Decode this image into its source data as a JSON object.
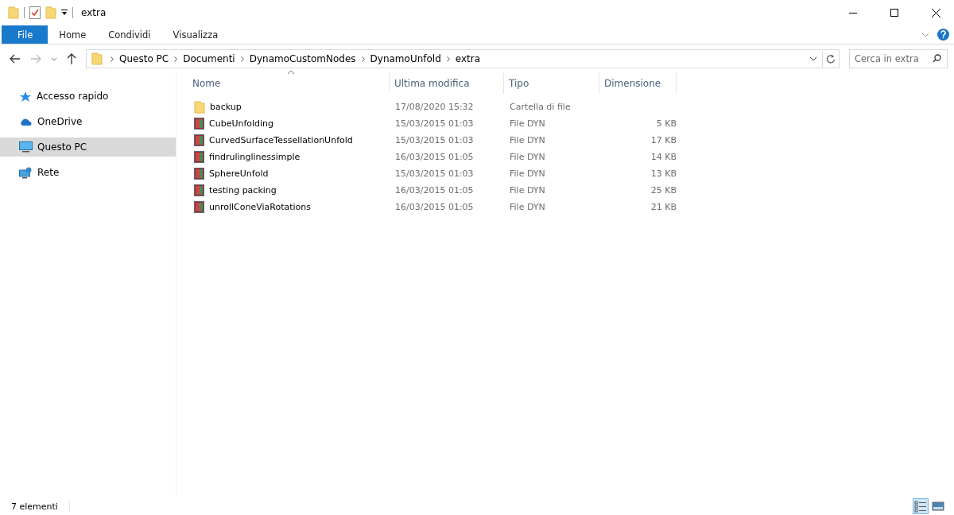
{
  "window": {
    "title": "extra"
  },
  "ribbon_tabs": [
    {
      "label": "File",
      "kind": "menu"
    },
    {
      "label": "Home",
      "kind": "tab"
    },
    {
      "label": "Condividi",
      "kind": "tab"
    },
    {
      "label": "Visualizza",
      "kind": "tab"
    }
  ],
  "address_bar": {
    "path": [
      "Questo PC",
      "Documenti",
      "DynamoCustomNodes",
      "DynamoUnfold",
      "extra"
    ]
  },
  "search": {
    "placeholder": "Cerca in extra"
  },
  "sidebar": {
    "items": [
      {
        "label": "Accesso rapido",
        "kind": "quick",
        "selected": false
      },
      {
        "label": "OneDrive",
        "kind": "cloud",
        "selected": false
      },
      {
        "label": "Questo PC",
        "kind": "pc",
        "selected": true
      },
      {
        "label": "Rete",
        "kind": "network",
        "selected": false
      }
    ]
  },
  "table": {
    "columns": [
      {
        "label": "Nome",
        "sorted": true
      },
      {
        "label": "Ultima modifica",
        "sorted": false
      },
      {
        "label": "Tipo",
        "sorted": false
      },
      {
        "label": "Dimensione",
        "sorted": false
      }
    ],
    "rows": [
      {
        "kind": "folder",
        "name": "backup",
        "modified": "17/08/2020 15:32",
        "type": "Cartella di file"
      },
      {
        "kind": "file",
        "name": "CubeUnfolding",
        "modified": "15/03/2015 01:03",
        "type": "File DYN",
        "size": "5 KB"
      },
      {
        "kind": "file",
        "name": "CurvedSurfaceTessellationUnfold",
        "modified": "15/03/2015 01:03",
        "type": "File DYN",
        "size": "17 KB"
      },
      {
        "kind": "file",
        "name": "findrulinglinessimple",
        "modified": "16/03/2015 01:05",
        "type": "File DYN",
        "size": "14 KB"
      },
      {
        "kind": "file",
        "name": "SphereUnfold",
        "modified": "15/03/2015 01:03",
        "type": "File DYN",
        "size": "13 KB"
      },
      {
        "kind": "file",
        "name": "testing packing",
        "modified": "16/03/2015 01:05",
        "type": "File DYN",
        "size": "25 KB"
      },
      {
        "kind": "file",
        "name": "unrollConeViaRotations",
        "modified": "16/03/2015 01:05",
        "type": "File DYN",
        "size": "21 KB"
      }
    ]
  },
  "status_bar": {
    "count": "7 elementi",
    "views": [
      {
        "kind": "details",
        "selected": true
      },
      {
        "kind": "large-icons",
        "selected": false
      }
    ]
  }
}
